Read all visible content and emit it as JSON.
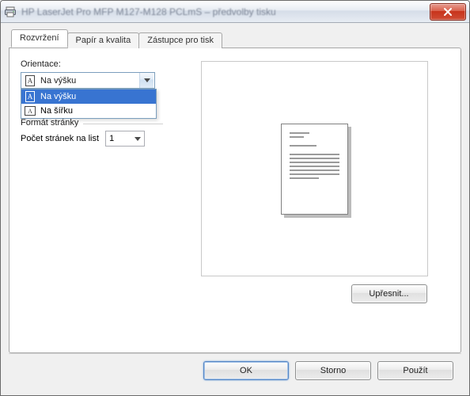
{
  "window": {
    "title": "HP LaserJet Pro MFP M127-M128 PCLmS – předvolby tisku"
  },
  "tabs": [
    {
      "id": "layout",
      "label": "Rozvržení"
    },
    {
      "id": "paper",
      "label": "Papír a kvalita"
    },
    {
      "id": "shortcut",
      "label": "Zástupce pro tisk"
    }
  ],
  "orientation": {
    "label": "Orientace:",
    "value_label": "Na výšku",
    "options": [
      {
        "id": "portrait",
        "label": "Na výšku"
      },
      {
        "id": "landscape",
        "label": "Na šířku"
      }
    ],
    "selected": "portrait"
  },
  "page_format": {
    "legend": "Formát stránky",
    "pages_per_sheet_label": "Počet stránek na list",
    "pages_per_sheet_value": "1"
  },
  "buttons": {
    "advanced": "Upřesnit...",
    "ok": "OK",
    "cancel": "Storno",
    "apply": "Použít"
  }
}
